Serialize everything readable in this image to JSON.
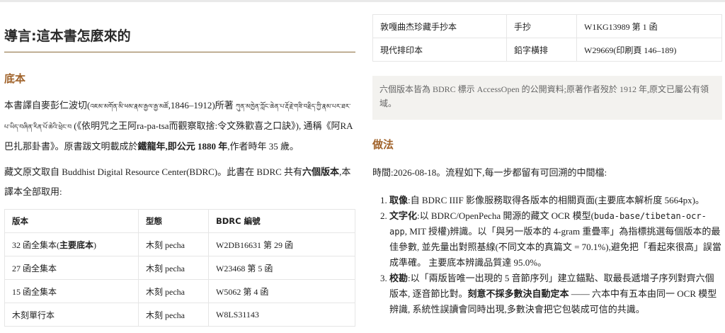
{
  "title": "導言:這本書怎麼來的",
  "section_source": "底本",
  "p1": {
    "a": "本書譯自麥彭仁波切(",
    "tib_name": "འཇམ་མགོན་མི་ཕམ་རྣམ་རྒྱལ་རྒྱ་མཚོ",
    "b": ",1846–1912)所著",
    "tib_title": "ཀུན་མཁྱེན་ཀློང་ཆེན་པ་རྡོ་རྗེ་གཟི་བརྗིད་ཀྱི་རྣམ་པར་ཐར་པ་ཡིད་བཞིན་རིན་པོ་ཆེའི་ཕྲེང་བ",
    "c": " (《依明咒之王阿ra-pa-tsa而觀察取捨:令文殊歡喜之口訣》), 通稱《阿RA巴扎那卦書》。原書跋文明載成於",
    "bold1": "鐵龍年,即公元 1880 年",
    "d": ",作者時年 35 歲。"
  },
  "p2": {
    "a": "藏文原文取自 Buddhist Digital Resource Center(BDRC)。此書在 BDRC 共有",
    "bold": "六個版本",
    "b": ",本譯本全部取用:"
  },
  "table": {
    "headers": [
      "版本",
      "型態",
      "BDRC 編號"
    ],
    "rows": [
      {
        "edition": "32 函全集本(",
        "edition_bold": "主要底本",
        "edition_end": ")",
        "form": "木刻 pecha",
        "id": "W2DB16631 第 29 函"
      },
      {
        "edition": "27 函全集本",
        "edition_bold": "",
        "edition_end": "",
        "form": "木刻 pecha",
        "id": "W23468 第 5 函"
      },
      {
        "edition": "15 函全集本",
        "edition_bold": "",
        "edition_end": "",
        "form": "木刻 pecha",
        "id": "W5062 第 4 函"
      },
      {
        "edition": "木刻單行本",
        "edition_bold": "",
        "edition_end": "",
        "form": "木刻 pecha",
        "id": "W8LS31143"
      },
      {
        "edition": "敦嘎曲杰珍藏手抄本",
        "edition_bold": "",
        "edition_end": "",
        "form": "手抄",
        "id": "W1KG13989 第 1 函"
      },
      {
        "edition": "現代排印本",
        "edition_bold": "",
        "edition_end": "",
        "form": "鉛字橫排",
        "id": "W29669(印刷頁 146–189)"
      }
    ]
  },
  "note": "六個版本皆為 BDRC 標示 AccessOpen 的公開資料;原著作者歿於 1912 年,原文已屬公有領域。",
  "section_method": "做法",
  "time_line": "時間:2026-08-18。流程如下,每一步都留有可回溯的中間檔:",
  "steps": {
    "s1": {
      "label": "取像",
      "text": ":自 BDRC IIIF 影像服務取得各版本的相關頁面(主要底本解析度 5664px)。"
    },
    "s2": {
      "label": "文字化",
      "a": ":以 BDRC/OpenPecha 開源的藏文 OCR 模型(",
      "code": "buda-base/tibetan-ocr-app",
      "b": ", MIT 授權)辨識。以「與另一版本的 4-gram 重疊率」為指標挑選每個版本的最佳參數, 並先量出對照基線(不同文本的真篇文 = 70.1%),避免把「看起來很高」誤當成準確。 主要底本辨識品質達 95.0%。"
    },
    "s3": {
      "label": "校勘",
      "a": ":以「兩版皆唯一出現的 5 音節序列」建立錨點、取最長遞增子序列對齊六個版本, 逐音節比對。",
      "bold": "刻意不採多數決自動定本",
      "b": " —— 六本中有五本由同一 OCR 模型辨識, 系統性誤讀會同時出現,多數決會把它包裝成可信的共識。"
    }
  }
}
